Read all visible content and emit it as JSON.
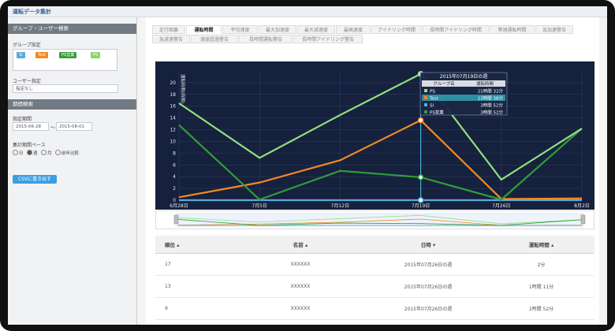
{
  "app": {
    "title": "運転データ集計"
  },
  "sidebar": {
    "section1_title": "グループ・ユーザー検索",
    "group_label": "グループ指定",
    "group_tags": [
      {
        "label": "SI",
        "color": "#5aa9d8"
      },
      {
        "label": "Test",
        "color": "#f08a24"
      },
      {
        "label": "PS営業",
        "color": "#3a9b3a"
      },
      {
        "label": "PS",
        "color": "#8bd36e"
      }
    ],
    "user_label": "ユーザー指定",
    "user_placeholder": "指定なし",
    "section2_title": "期間検索",
    "period_label": "指定期間",
    "date_from": "2015-06-28",
    "date_sep": "〜",
    "date_to": "2015-08-01",
    "base_label": "集計期間ベース",
    "radios": [
      {
        "label": "日",
        "selected": false
      },
      {
        "label": "週",
        "selected": true
      },
      {
        "label": "月",
        "selected": false
      },
      {
        "label": "前年比較",
        "selected": false
      }
    ],
    "csv_button": "CSVに書き出す"
  },
  "tabs_row1": [
    "走行距離",
    "運転時間",
    "平均速度",
    "最大加速度",
    "最大減速度",
    "最高速度",
    "アイドリング時間",
    "長時間アイドリング時間",
    "等速運転時間",
    "急加速警告"
  ],
  "tabs_row2": [
    "急減速警告",
    "速度超過警告",
    "長時間運転警告",
    "長時間アイドリング警告"
  ],
  "active_tab": "運転時間",
  "chart_data": {
    "type": "line",
    "ylabel": "運転時間(時間)",
    "ylim": [
      0,
      22
    ],
    "yticks": [
      0,
      2,
      4,
      6,
      8,
      10,
      12,
      14,
      16,
      18,
      20
    ],
    "categories": [
      "6月28日",
      "7月5日",
      "7月12日",
      "7月19日",
      "7月26日",
      "8月2日"
    ],
    "series": [
      {
        "name": "PS",
        "color": "#90e080",
        "values": [
          16.5,
          7.2,
          14.5,
          21.5,
          3.5,
          12.2
        ]
      },
      {
        "name": "Test",
        "color": "#f08a24",
        "values": [
          0.5,
          3,
          6.8,
          13.6,
          0.2,
          0.3
        ]
      },
      {
        "name": "SI",
        "color": "#5aa9d8",
        "values": [
          0,
          0,
          0,
          0,
          0,
          0
        ]
      },
      {
        "name": "PS営業",
        "color": "#2f9e3a",
        "values": [
          12.8,
          0.1,
          5.0,
          3.9,
          0.1,
          12.2
        ]
      }
    ],
    "tooltip": {
      "title": "2015年07月19日の週",
      "col1": "グループ名",
      "col2": "運転時間",
      "rows": [
        {
          "name": "PS",
          "color": "#90e080",
          "value": "21時間 32分"
        },
        {
          "name": "Test",
          "color": "#f08a24",
          "value": "13時間 38分"
        },
        {
          "name": "SI",
          "color": "#5aa9d8",
          "value": "3時間 52分"
        },
        {
          "name": "PS営業",
          "color": "#2f9e3a",
          "value": "3時間 52分"
        }
      ]
    }
  },
  "table": {
    "headers": [
      "順位",
      "名前",
      "日時",
      "運転時間"
    ],
    "rows": [
      [
        "17",
        "XXXXXX",
        "2015年07月26日の週",
        "2分"
      ],
      [
        "13",
        "XXXXXX",
        "2015年07月26日の週",
        "1時間 11分"
      ],
      [
        "9",
        "XXXXXX",
        "2015年07月26日の週",
        "2時間 52分"
      ]
    ]
  }
}
